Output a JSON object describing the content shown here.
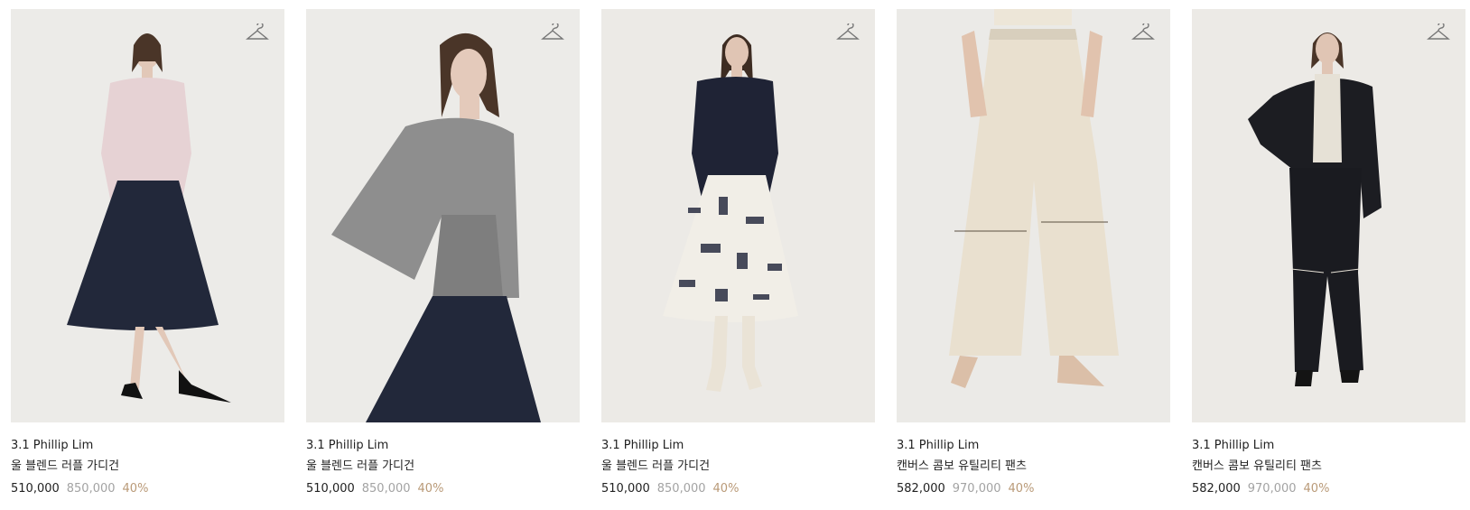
{
  "colors": {
    "discount": "#b99a78",
    "original_price": "#a3a3a3",
    "text": "#222222"
  },
  "products": [
    {
      "brand": "3.1 Phillip Lim",
      "name": "울 블렌드 러플 가디건",
      "sale_price": "510,000",
      "original_price": "850,000",
      "discount": "40%",
      "wishlist_icon": "hanger-icon"
    },
    {
      "brand": "3.1 Phillip Lim",
      "name": "울 블렌드 러플 가디건",
      "sale_price": "510,000",
      "original_price": "850,000",
      "discount": "40%",
      "wishlist_icon": "hanger-icon"
    },
    {
      "brand": "3.1 Phillip Lim",
      "name": "울 블렌드 러플 가디건",
      "sale_price": "510,000",
      "original_price": "850,000",
      "discount": "40%",
      "wishlist_icon": "hanger-icon"
    },
    {
      "brand": "3.1 Phillip Lim",
      "name": "캔버스 콤보 유틸리티 팬츠",
      "sale_price": "582,000",
      "original_price": "970,000",
      "discount": "40%",
      "wishlist_icon": "hanger-icon"
    },
    {
      "brand": "3.1 Phillip Lim",
      "name": "캔버스 콤보 유틸리티 팬츠",
      "sale_price": "582,000",
      "original_price": "970,000",
      "discount": "40%",
      "wishlist_icon": "hanger-icon"
    }
  ]
}
